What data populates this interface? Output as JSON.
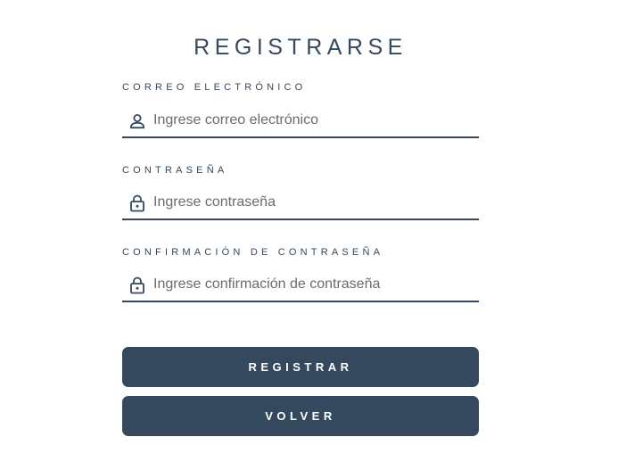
{
  "form": {
    "title": "REGISTRARSE",
    "email": {
      "label": "CORREO ELECTRÓNICO",
      "placeholder": "Ingrese correo electrónico",
      "value": "",
      "icon": "user-icon"
    },
    "password": {
      "label": "CONTRASEÑA",
      "placeholder": "Ingrese contraseña",
      "value": "",
      "icon": "lock-icon"
    },
    "confirm": {
      "label": "CONFIRMACIÓN DE CONTRASEÑA",
      "placeholder": "Ingrese confirmación de contraseña",
      "value": "",
      "icon": "lock-icon"
    },
    "register_label": "REGISTRAR",
    "back_label": "VOLVER"
  },
  "colors": {
    "primary": "#34495e",
    "background": "#ffffff",
    "placeholder": "#6b6b6b"
  }
}
